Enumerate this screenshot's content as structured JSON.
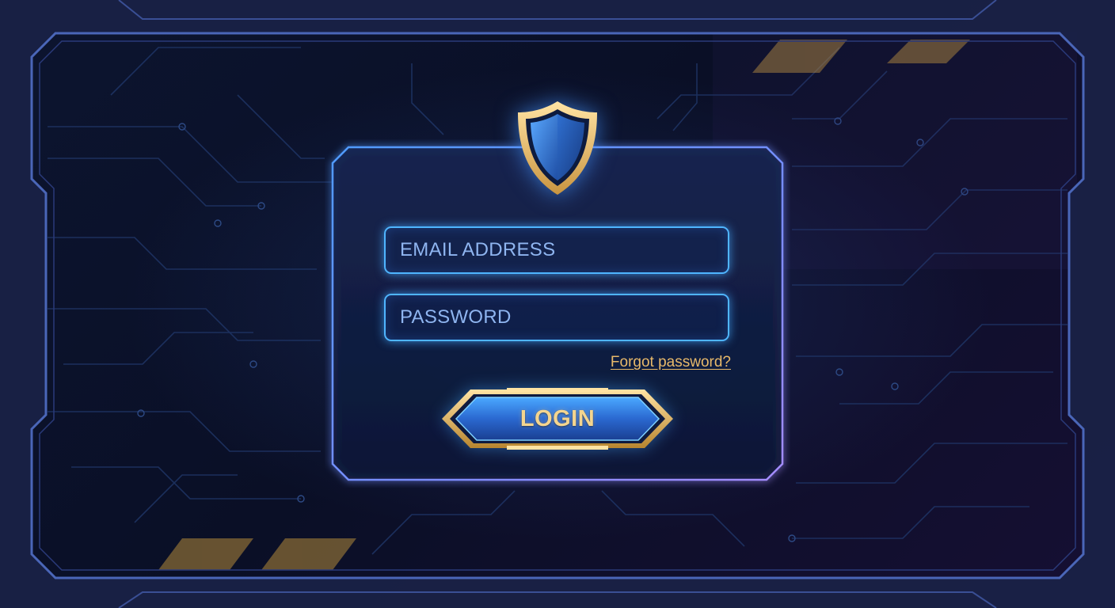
{
  "login_form": {
    "email_placeholder": "EMAIL ADDRESS",
    "email_value": "",
    "password_placeholder": "PASSWORD",
    "password_value": "",
    "forgot_password_label": "Forgot password?",
    "login_label": "LOGIN"
  },
  "icons": {
    "emblem": "shield-icon"
  },
  "colors": {
    "background": "#0a0f26",
    "field_border": "#4fb5ff",
    "accent_gold": "#e8b96a",
    "login_text": "#f4d58f",
    "panel_border": "#6aa8ff"
  }
}
